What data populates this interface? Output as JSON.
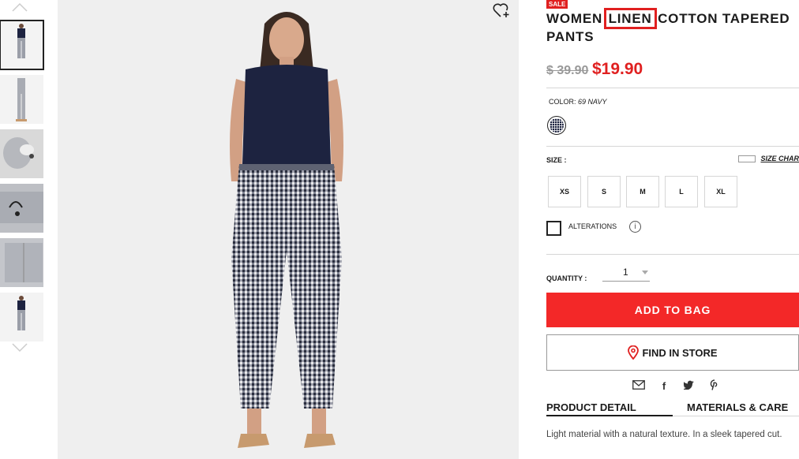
{
  "product": {
    "badge": "SALE",
    "title_before": "WOMEN ",
    "title_highlight": "LINEN",
    "title_after": " COTTON TAPERED PANTS",
    "price_original": "$ 39.90",
    "price_sale": "$19.90",
    "description": "Light material with a natural texture. In a sleek tapered cut."
  },
  "color": {
    "label": "COLOR:",
    "value": "69 NAVY",
    "swatch_color": "#1d2340"
  },
  "size": {
    "label": "SIZE :",
    "chart_link": "SIZE CHAR",
    "options": [
      "XS",
      "S",
      "M",
      "L",
      "XL"
    ]
  },
  "alterations": {
    "label": "ALTERATIONS",
    "info_icon": "info-icon"
  },
  "quantity": {
    "label": "QUANTITY :",
    "value": "1"
  },
  "actions": {
    "add_to_bag": "ADD TO BAG",
    "find_in_store": "FIND IN STORE"
  },
  "share_icons": [
    "mail-icon",
    "facebook-icon",
    "twitter-icon",
    "pinterest-icon"
  ],
  "tabs": [
    "PRODUCT DETAIL",
    "MATERIALS & CARE"
  ],
  "gallery": {
    "thumbnail_count": 6,
    "active_index": 0
  },
  "colors": {
    "accent": "#f32828",
    "sale_badge": "#e02020",
    "text": "#1b1b1b"
  }
}
